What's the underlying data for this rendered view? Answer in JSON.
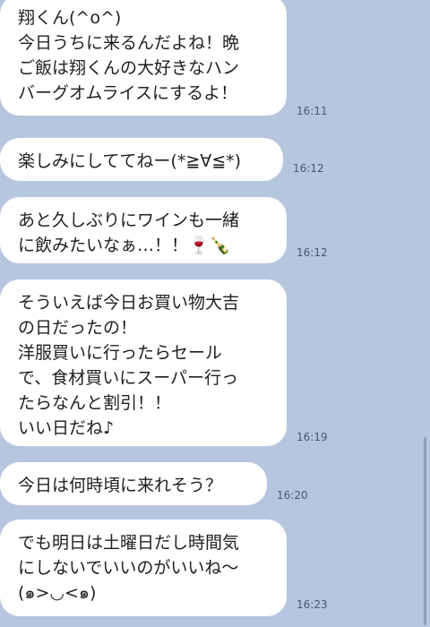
{
  "messages": [
    {
      "text": "翔くん(^o^)\n今日うちに来るんだよね！晩\nご飯は翔くんの大好きなハン\nバーグオムライスにするよ！",
      "time": "16:11"
    },
    {
      "text": "楽しみにしててねー(*≧∀≦*)",
      "time": "16:12"
    },
    {
      "text": "あと久しぶりにワインも一緒\nに飲みたいなぁ…！！🍷🍾",
      "time": "16:12"
    },
    {
      "text": "そういえば今日お買い物大吉\nの日だったの！\n洋服買いに行ったらセール\nで、食材買いにスーパー行っ\nたらなんと割引！！\nいい日だね♪",
      "time": "16:19"
    },
    {
      "text": "今日は何時頃に来れそう？",
      "time": "16:20"
    },
    {
      "text": "でも明日は土曜日だし時間気\nにしないでいいのがいいね〜\n(๑>◡<๑)",
      "time": "16:23"
    }
  ]
}
